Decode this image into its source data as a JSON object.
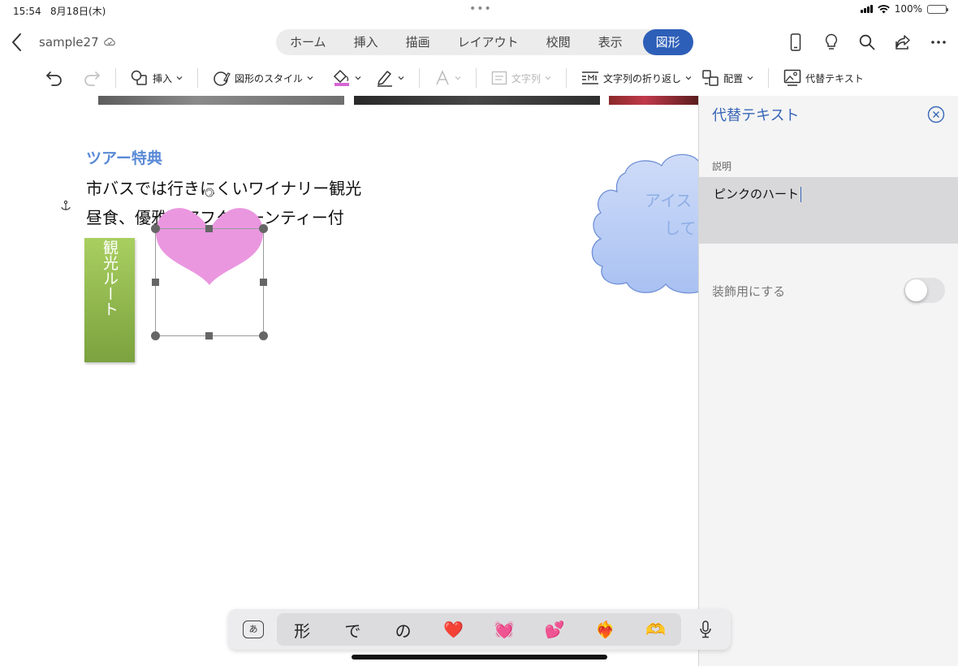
{
  "status": {
    "time": "15:54",
    "date": "8月18日(木)",
    "dots": "•••",
    "battery": "100%",
    "battery_level": 1.0
  },
  "title": {
    "doc_name": "sample27"
  },
  "tabs": [
    {
      "label": "ホーム"
    },
    {
      "label": "挿入"
    },
    {
      "label": "描画"
    },
    {
      "label": "レイアウト"
    },
    {
      "label": "校閲"
    },
    {
      "label": "表示"
    },
    {
      "label": "図形",
      "active": true
    }
  ],
  "ribbon": {
    "insert": "挿入",
    "shape_style": "図形のスタイル",
    "text_direction": "文字列",
    "wrap_text": "文字列の折り返し",
    "arrange": "配置",
    "alt_text": "代替テキスト"
  },
  "document": {
    "heading": "ツアー特典",
    "line1": "市バスでは行きにくいワイナリー観光",
    "line2": "昼食、優雅なアフタヌーンティー付",
    "green_box_text": "観光ルート",
    "cloud_text_line1": "アイス",
    "cloud_text_line2": "して"
  },
  "panel": {
    "title": "代替テキスト",
    "description_label": "説明",
    "description_value": "ピンクのハート",
    "decorative_label": "装飾用にする",
    "decorative_on": false
  },
  "keyboard": {
    "lang": "あ",
    "suggestions": [
      "形",
      "で",
      "の",
      "❤️",
      "💓",
      "💕",
      "❤️‍🔥",
      "🫶"
    ]
  },
  "colors": {
    "accent": "#2e5fb8",
    "heading": "#5a8ad6",
    "heart": "#ea97e0",
    "green": "#8fba4a",
    "cloud": "#b9cdf5"
  }
}
